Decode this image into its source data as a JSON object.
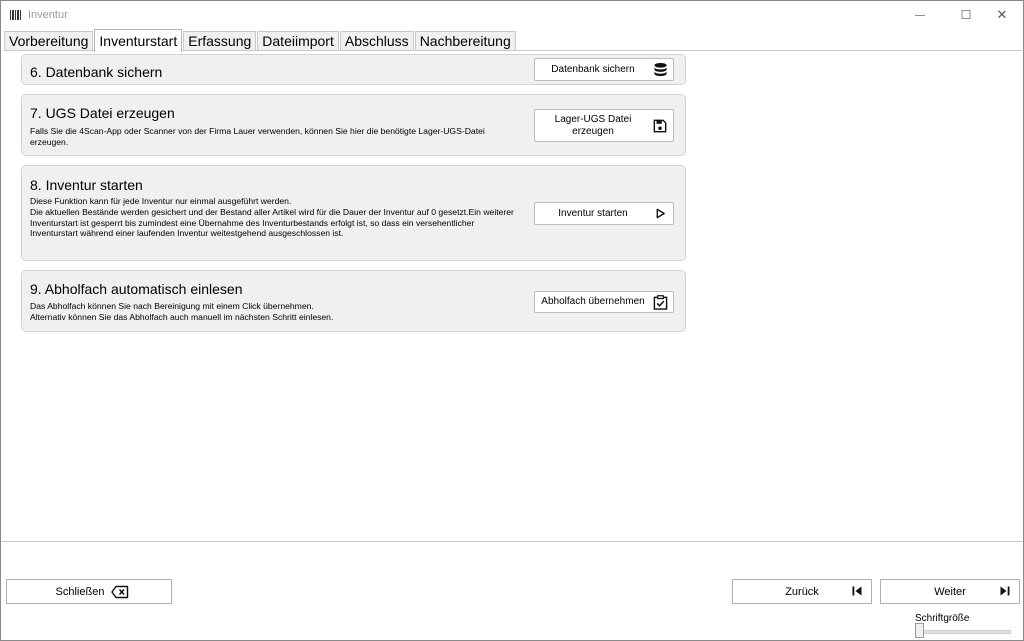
{
  "window": {
    "title": "Inventur",
    "minimize_glyph": "—",
    "maximize_glyph": "☐",
    "close_glyph": "✕"
  },
  "tabs": [
    {
      "label": "Vorbereitung",
      "active": false
    },
    {
      "label": "Inventurstart",
      "active": true
    },
    {
      "label": "Erfassung",
      "active": false
    },
    {
      "label": "Dateiimport",
      "active": false
    },
    {
      "label": "Abschluss",
      "active": false
    },
    {
      "label": "Nachbereitung",
      "active": false
    }
  ],
  "sections": {
    "backup": {
      "title": "6. Datenbank sichern",
      "button_label": "Datenbank sichern",
      "icon": "database-icon"
    },
    "ugs": {
      "title": "7. UGS Datei erzeugen",
      "description": "Falls Sie die 4Scan-App oder Scanner von der Firma Lauer verwenden, können Sie hier die benötigte Lager-UGS-Datei erzeugen.",
      "button_label": "Lager-UGS Datei erzeugen",
      "icon": "save-icon"
    },
    "start": {
      "title": "8. Inventur starten",
      "description_line1": "Diese Funktion kann für jede Inventur nur einmal ausgeführt werden.",
      "description_line2": "Die aktuellen Bestände werden gesichert und der Bestand aller Artikel wird für die Dauer der Inventur auf 0 gesetzt.Ein weiterer Inventurstart ist gesperrt bis zumindest eine Übernahme des Inventurbestands erfolgt ist, so dass ein versehentlicher Inventurstart während einer laufenden Inventur weitestgehend ausgeschlossen ist.",
      "button_label": "Inventur starten",
      "icon": "play-icon"
    },
    "pickup": {
      "title": "9. Abholfach automatisch einlesen",
      "description_line1": "Das Abholfach können Sie nach Bereinigung mit einem Click übernehmen.",
      "description_line2": "Alternativ können Sie das Abholfach auch manuell im nächsten Schritt einlesen.",
      "button_label": "Abholfach übernehmen",
      "icon": "clipboard-check-icon"
    }
  },
  "footer": {
    "close_label": "Schließen",
    "back_label": "Zurück",
    "next_label": "Weiter",
    "font_size_label": "Schriftgröße",
    "font_size_level": 0
  }
}
